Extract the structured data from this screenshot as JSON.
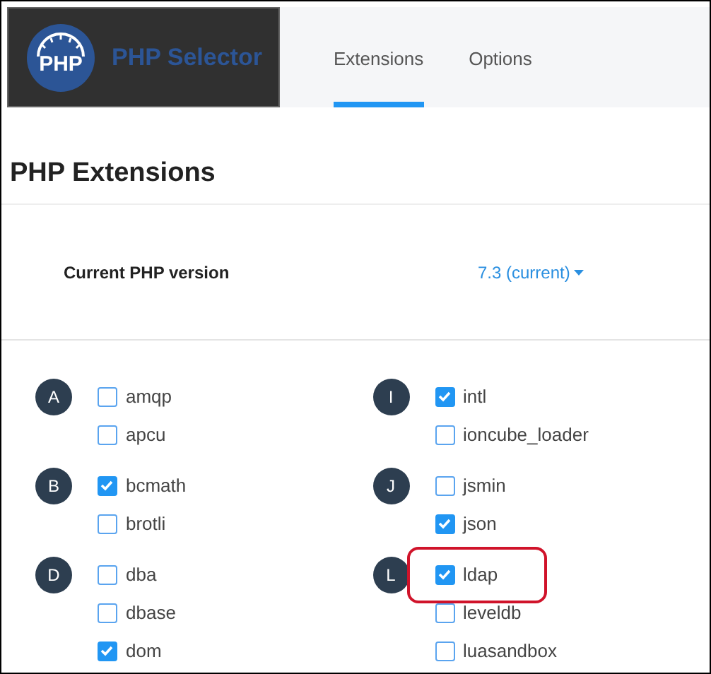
{
  "header": {
    "title": "PHP Selector",
    "logo_text": "PHP"
  },
  "tabs": [
    {
      "label": "Extensions",
      "selected": true
    },
    {
      "label": "Options",
      "selected": false
    }
  ],
  "heading": "PHP Extensions",
  "version": {
    "label": "Current PHP version",
    "value": "7.3 (current)"
  },
  "columns": [
    {
      "groups": [
        {
          "letter": "A",
          "extensions": [
            {
              "name": "amqp",
              "checked": false,
              "highlighted": false
            },
            {
              "name": "apcu",
              "checked": false,
              "highlighted": false
            }
          ]
        },
        {
          "letter": "B",
          "extensions": [
            {
              "name": "bcmath",
              "checked": true,
              "highlighted": false
            },
            {
              "name": "brotli",
              "checked": false,
              "highlighted": false
            }
          ]
        },
        {
          "letter": "D",
          "extensions": [
            {
              "name": "dba",
              "checked": false,
              "highlighted": false
            },
            {
              "name": "dbase",
              "checked": false,
              "highlighted": false
            },
            {
              "name": "dom",
              "checked": true,
              "highlighted": false
            }
          ]
        }
      ]
    },
    {
      "groups": [
        {
          "letter": "I",
          "extensions": [
            {
              "name": "intl",
              "checked": true,
              "highlighted": false
            },
            {
              "name": "ioncube_loader",
              "checked": false,
              "highlighted": false
            }
          ]
        },
        {
          "letter": "J",
          "extensions": [
            {
              "name": "jsmin",
              "checked": false,
              "highlighted": false
            },
            {
              "name": "json",
              "checked": true,
              "highlighted": false
            }
          ]
        },
        {
          "letter": "L",
          "extensions": [
            {
              "name": "ldap",
              "checked": true,
              "highlighted": true
            },
            {
              "name": "leveldb",
              "checked": false,
              "highlighted": false
            },
            {
              "name": "luasandbox",
              "checked": false,
              "highlighted": false
            }
          ]
        }
      ]
    }
  ]
}
